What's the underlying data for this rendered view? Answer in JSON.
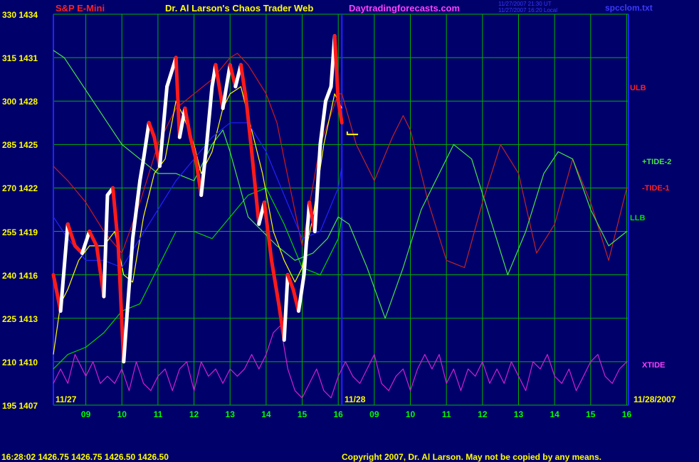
{
  "header": {
    "instrument": "S&P E-Mini",
    "title": "Dr. Al Larson's Chaos Trader Web",
    "site": "Daytradingforecasts.com",
    "stamp1": "11/27/2007 21:30 UT",
    "stamp2": "11/27/2007 16:20 Local",
    "file": "spcclom.txt"
  },
  "footer": {
    "status": "16:28:02  1426.75  1426.75  1426.50  1426.50",
    "copyright": "Copyright 2007, Dr. Al Larson. May not be copied by any means."
  },
  "date_labels": {
    "start": "11/27",
    "mid": "11/28",
    "end": "11/28/2007"
  },
  "colors": {
    "background": "#00006b",
    "grid": "#00b400",
    "price_up": "#ffffff",
    "price_down": "#ff1a1a",
    "ulb": "#d21818",
    "llb": "#00d400",
    "tide2": "#48e448",
    "tide1": "#c02424",
    "xtide": "#d020d0",
    "yellow": "#ffff00",
    "blue": "#2222ff"
  },
  "chart_data": {
    "type": "line",
    "title": "S&P E-Mini",
    "xlabel": "",
    "ylabel": "",
    "y_ticks": [
      {
        "left": "330",
        "right": "1434"
      },
      {
        "left": "315",
        "right": "1431"
      },
      {
        "left": "300",
        "right": "1428"
      },
      {
        "left": "285",
        "right": "1425"
      },
      {
        "left": "270",
        "right": "1422"
      },
      {
        "left": "255",
        "right": "1419"
      },
      {
        "left": "240",
        "right": "1416"
      },
      {
        "left": "225",
        "right": "1413"
      },
      {
        "left": "210",
        "right": "1410"
      },
      {
        "left": "195",
        "right": "1407"
      }
    ],
    "ylim": [
      1407,
      1434
    ],
    "x_ticks": [
      "09",
      "10",
      "11",
      "12",
      "13",
      "14",
      "15",
      "16",
      "09",
      "10",
      "11",
      "12",
      "13",
      "14",
      "15",
      "16"
    ],
    "xlim": [
      8.1,
      24.05
    ],
    "grid": true,
    "legend": [
      "ULB",
      "+TIDE-2",
      "-TIDE-1",
      "LLB",
      "XTIDE"
    ],
    "series": [
      {
        "name": "Price",
        "x": [
          8.1,
          8.3,
          8.5,
          8.7,
          8.9,
          9.1,
          9.3,
          9.5,
          9.6,
          9.75,
          9.9,
          10.05,
          10.15,
          10.3,
          10.5,
          10.6,
          10.75,
          10.9,
          11.05,
          11.25,
          11.5,
          11.6,
          11.75,
          11.9,
          12.05,
          12.2,
          12.35,
          12.5,
          12.6,
          12.8,
          13.0,
          13.15,
          13.3,
          13.45,
          13.6,
          13.8,
          13.95,
          14.15,
          14.35,
          14.5,
          14.6,
          14.75,
          14.9,
          15.05,
          15.2,
          15.35,
          15.5,
          15.65,
          15.8,
          15.9,
          16.0,
          16.1
        ],
        "y": [
          1416.0,
          1413.5,
          1419.5,
          1418.0,
          1417.5,
          1419.0,
          1418.0,
          1414.5,
          1421.5,
          1422.0,
          1418.0,
          1410.0,
          1413.5,
          1418.5,
          1422.5,
          1424.0,
          1426.5,
          1425.5,
          1423.5,
          1429.0,
          1431.0,
          1425.5,
          1427.5,
          1425.5,
          1424.0,
          1421.5,
          1425.0,
          1429.0,
          1430.5,
          1427.5,
          1430.5,
          1429.0,
          1430.5,
          1428.0,
          1424.5,
          1419.5,
          1421.0,
          1417.0,
          1414.0,
          1411.5,
          1416.0,
          1415.0,
          1413.5,
          1416.0,
          1421.0,
          1419.0,
          1425.0,
          1428.0,
          1429.0,
          1432.5,
          1428.0,
          1426.5
        ]
      },
      {
        "name": "ULB",
        "x": [
          8.1,
          8.5,
          9.0,
          9.5,
          10.0,
          10.5,
          11.0,
          11.5,
          12.0,
          12.5,
          13.0,
          13.2,
          13.5,
          14.0,
          14.3,
          14.5,
          15.0,
          15.5,
          16.0,
          16.1
        ],
        "y": [
          1423.5,
          1422.5,
          1421.0,
          1419.0,
          1417.5,
          1421.0,
          1425.0,
          1427.5,
          1428.5,
          1429.5,
          1431.0,
          1431.3,
          1430.5,
          1428.5,
          1426.5,
          1424.0,
          1418.0,
          1425.0,
          1428.5,
          1428.5
        ]
      },
      {
        "name": "ULB-forecast",
        "x": [
          16.1,
          16.5,
          17.0,
          17.5,
          17.8,
          18.0,
          18.5,
          19.0,
          19.5,
          20.0,
          20.5,
          21.0,
          21.5,
          22.0,
          22.5,
          23.0,
          23.5,
          24.0
        ],
        "y": [
          1428.5,
          1425.0,
          1422.5,
          1425.5,
          1427.0,
          1426.0,
          1421.0,
          1417.0,
          1416.5,
          1421.0,
          1425.0,
          1423.0,
          1417.5,
          1419.5,
          1424.0,
          1421.0,
          1417.0,
          1422.0
        ]
      },
      {
        "name": "LLB",
        "x": [
          8.1,
          8.5,
          9.0,
          9.5,
          10.0,
          10.5,
          11.0,
          11.5,
          12.0,
          12.5,
          13.0,
          13.5,
          14.0,
          14.5,
          15.0,
          15.5,
          16.0,
          16.1
        ],
        "y": [
          1409.5,
          1410.5,
          1411.0,
          1412.0,
          1413.5,
          1414.0,
          1416.5,
          1419.0,
          1419.0,
          1418.5,
          1420.0,
          1421.5,
          1422.0,
          1419.5,
          1416.5,
          1416.0,
          1418.5,
          1420.0
        ]
      },
      {
        "name": "+TIDE-2",
        "x": [
          8.1,
          8.4,
          8.8,
          9.2,
          9.6,
          10.0,
          10.5,
          11.0,
          11.5,
          12.0,
          12.5,
          12.8,
          13.0,
          13.5,
          13.9,
          14.3,
          14.8,
          15.3,
          15.7,
          16.0,
          16.3,
          16.8,
          17.3,
          17.8,
          18.3,
          18.8,
          19.2,
          19.7,
          20.2,
          20.7,
          21.2,
          21.7,
          22.1,
          22.5,
          23.0,
          23.5,
          24.0
        ],
        "y": [
          1431.5,
          1431.0,
          1429.5,
          1428.0,
          1426.5,
          1425.0,
          1424.0,
          1423.0,
          1423.0,
          1422.5,
          1425.0,
          1426.0,
          1424.5,
          1420.0,
          1419.0,
          1418.0,
          1417.0,
          1417.5,
          1418.5,
          1420.0,
          1419.5,
          1416.5,
          1413.0,
          1416.5,
          1420.5,
          1423.0,
          1425.0,
          1424.0,
          1420.0,
          1416.0,
          1419.0,
          1423.0,
          1424.5,
          1424.0,
          1420.5,
          1418.0,
          1419.0
        ]
      },
      {
        "name": "Yellow-avg",
        "x": [
          8.1,
          8.3,
          8.5,
          8.8,
          9.1,
          9.5,
          9.8,
          10.05,
          10.3,
          10.6,
          10.9,
          11.2,
          11.5,
          11.7,
          12.0,
          12.2,
          12.5,
          12.8,
          13.0,
          13.3,
          13.6,
          13.9,
          14.2,
          14.5,
          14.8,
          15.0,
          15.3,
          15.6,
          15.9,
          16.1
        ],
        "y": [
          1410.5,
          1414.0,
          1415.0,
          1417.0,
          1418.0,
          1418.0,
          1419.0,
          1416.0,
          1415.5,
          1420.0,
          1423.0,
          1424.0,
          1428.0,
          1427.0,
          1425.0,
          1423.0,
          1424.5,
          1427.5,
          1428.5,
          1429.0,
          1426.0,
          1423.0,
          1419.0,
          1417.0,
          1415.5,
          1416.5,
          1420.0,
          1425.0,
          1428.5,
          1427.5
        ]
      },
      {
        "name": "Blue-avg",
        "x": [
          8.1,
          8.5,
          9.0,
          9.5,
          10.0,
          10.5,
          11.0,
          11.5,
          12.0,
          12.5,
          13.0,
          13.5,
          14.0,
          14.5,
          15.0,
          15.5,
          16.0,
          16.1
        ],
        "y": [
          1420.0,
          1418.5,
          1417.0,
          1417.0,
          1416.5,
          1418.5,
          1420.5,
          1422.5,
          1424.0,
          1425.5,
          1426.5,
          1426.5,
          1424.5,
          1421.5,
          1418.5,
          1419.0,
          1422.0,
          1423.5
        ]
      },
      {
        "name": "XTIDE",
        "x": [
          8.1,
          8.3,
          8.5,
          8.7,
          9.0,
          9.2,
          9.4,
          9.6,
          9.8,
          10.0,
          10.2,
          10.4,
          10.6,
          10.8,
          11.0,
          11.2,
          11.4,
          11.6,
          11.8,
          12.0,
          12.2,
          12.4,
          12.6,
          12.8,
          13.0,
          13.2,
          13.4,
          13.6,
          13.8,
          14.0,
          14.2,
          14.4,
          14.6,
          14.8,
          15.0,
          15.2,
          15.4,
          15.6,
          15.8,
          16.0,
          16.2,
          16.4,
          16.6,
          16.8,
          17.0,
          17.2,
          17.4,
          17.6,
          17.8,
          18.0,
          18.2,
          18.4,
          18.6,
          18.8,
          19.0,
          19.2,
          19.4,
          19.6,
          19.8,
          20.0,
          20.2,
          20.4,
          20.6,
          20.8,
          21.0,
          21.2,
          21.4,
          21.6,
          21.8,
          22.0,
          22.2,
          22.4,
          22.6,
          22.8,
          23.0,
          23.2,
          23.4,
          23.6,
          23.8,
          24.0
        ],
        "y": [
          1408.5,
          1409.5,
          1408.5,
          1410.5,
          1409.0,
          1410.0,
          1408.5,
          1409.0,
          1408.5,
          1409.5,
          1408.0,
          1410.0,
          1408.5,
          1408.0,
          1409.0,
          1409.5,
          1408.0,
          1409.5,
          1410.0,
          1408.0,
          1410.0,
          1409.0,
          1409.5,
          1408.5,
          1409.5,
          1409.0,
          1409.5,
          1410.5,
          1409.5,
          1410.5,
          1412.0,
          1412.5,
          1409.5,
          1408.0,
          1407.5,
          1408.5,
          1409.5,
          1408.0,
          1407.5,
          1409.0,
          1410.0,
          1409.0,
          1408.5,
          1409.5,
          1410.5,
          1408.5,
          1408.0,
          1409.0,
          1409.5,
          1408.0,
          1409.5,
          1410.5,
          1409.5,
          1410.5,
          1408.5,
          1409.5,
          1408.0,
          1409.5,
          1409.0,
          1410.0,
          1408.5,
          1409.5,
          1408.5,
          1410.0,
          1409.0,
          1408.0,
          1410.0,
          1409.5,
          1410.5,
          1409.0,
          1408.5,
          1409.5,
          1408.0,
          1409.0,
          1410.0,
          1410.5,
          1409.0,
          1408.5,
          1409.5,
          1410.0
        ]
      }
    ]
  }
}
